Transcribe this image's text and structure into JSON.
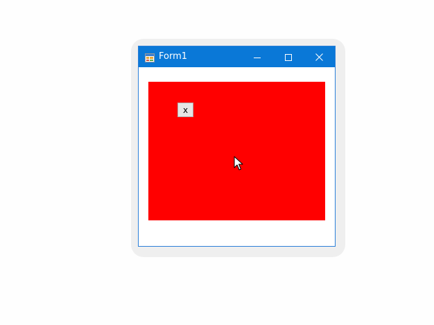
{
  "window": {
    "title": "Form1"
  },
  "icons": {
    "app": "winforms-app-icon",
    "minimize": "minimize-icon",
    "maximize": "maximize-icon",
    "close": "close-icon",
    "cursor": "mouse-pointer-icon"
  },
  "panel": {
    "color": "#ff0000",
    "button_label": "x"
  },
  "colors": {
    "titlebar": "#0a78d7",
    "panel": "#ff0000",
    "window_border": "#2b7fd8"
  }
}
